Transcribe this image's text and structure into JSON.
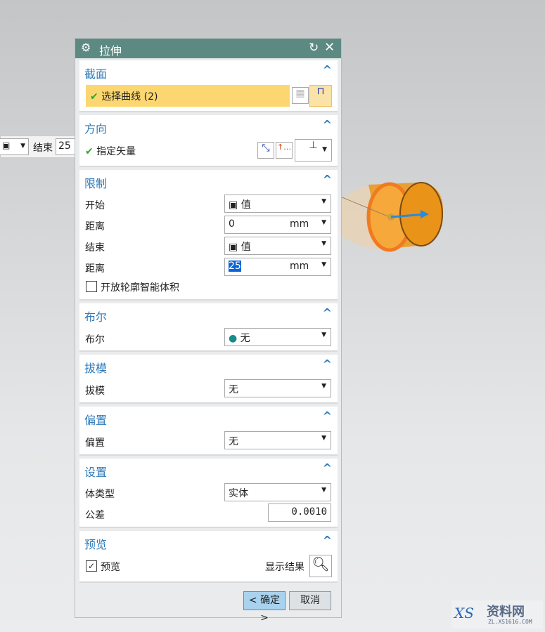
{
  "toolbar_fragment": {
    "end_label": "结束",
    "end_value": "25"
  },
  "dialog": {
    "title": "拉伸",
    "reset_icon": "reset-icon",
    "close_icon": "close-icon"
  },
  "section": {
    "title": "截面",
    "select_curve": "选择曲线 (2)"
  },
  "direction": {
    "title": "方向",
    "specify_vector": "指定矢量"
  },
  "limits": {
    "title": "限制",
    "start_label": "开始",
    "start_value": "值",
    "start_dist_label": "距离",
    "start_dist": "0",
    "unit": "mm",
    "end_label": "结束",
    "end_value": "值",
    "end_dist_label": "距离",
    "end_dist": "25",
    "open_profile": "开放轮廓智能体积"
  },
  "boolean": {
    "title": "布尔",
    "label": "布尔",
    "value": "无"
  },
  "draft": {
    "title": "拔模",
    "label": "拔模",
    "value": "无"
  },
  "offset": {
    "title": "偏置",
    "label": "偏置",
    "value": "无"
  },
  "settings": {
    "title": "设置",
    "body_type_label": "体类型",
    "body_type": "实体",
    "tolerance_label": "公差",
    "tolerance": "0.0010"
  },
  "preview": {
    "title": "预览",
    "preview_label": "预览",
    "preview_checked": true,
    "show_result": "显示结果"
  },
  "buttons": {
    "ok": "< 确定 >",
    "cancel": "取消"
  },
  "watermark": {
    "text": "资料网",
    "url": "ZL.XS1616.COM"
  },
  "colors": {
    "title_bar": "#5c8a82",
    "section_title": "#2f7ab8",
    "selection": "#fcd670",
    "ok_button": "#a8d2ee"
  }
}
